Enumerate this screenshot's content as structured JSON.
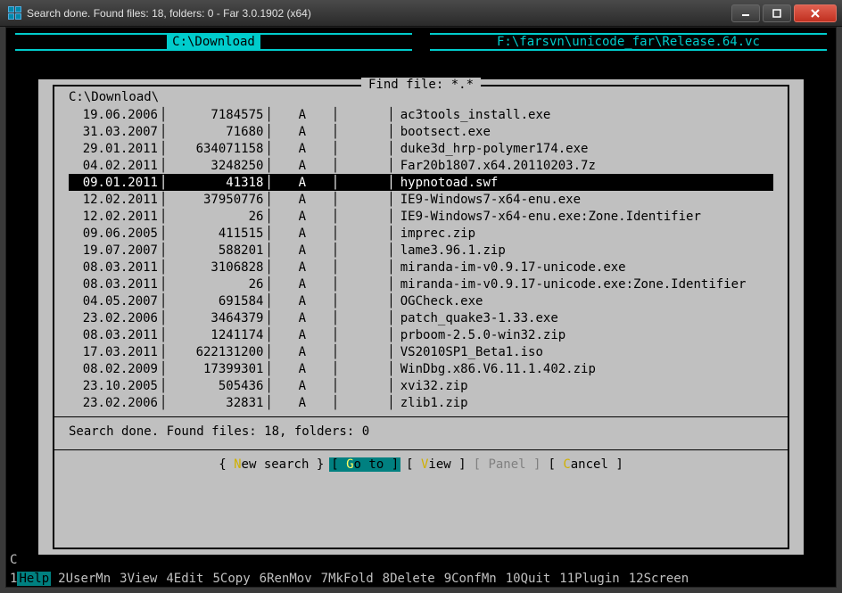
{
  "window": {
    "title": "Search done. Found files: 18, folders: 0 - Far 3.0.1902 (x64)"
  },
  "panels": {
    "left": "C:\\Download",
    "right": "F:\\farsvn\\unicode_far\\Release.64.vc"
  },
  "dialog": {
    "title": " Find file: *.* ",
    "path": "C:\\Download\\",
    "rows": [
      {
        "date": "19.06.2006",
        "size": "7184575",
        "attr": "A",
        "name": "ac3tools_install.exe",
        "selected": false
      },
      {
        "date": "31.03.2007",
        "size": "71680",
        "attr": "A",
        "name": "bootsect.exe",
        "selected": false
      },
      {
        "date": "29.01.2011",
        "size": "634071158",
        "attr": "A",
        "name": "duke3d_hrp-polymer174.exe",
        "selected": false
      },
      {
        "date": "04.02.2011",
        "size": "3248250",
        "attr": "A",
        "name": "Far20b1807.x64.20110203.7z",
        "selected": false
      },
      {
        "date": "09.01.2011",
        "size": "41318",
        "attr": "A",
        "name": "hypnotoad.swf",
        "selected": true
      },
      {
        "date": "12.02.2011",
        "size": "37950776",
        "attr": "A",
        "name": "IE9-Windows7-x64-enu.exe",
        "selected": false
      },
      {
        "date": "12.02.2011",
        "size": "26",
        "attr": "A",
        "name": "IE9-Windows7-x64-enu.exe:Zone.Identifier",
        "selected": false
      },
      {
        "date": "09.06.2005",
        "size": "411515",
        "attr": "A",
        "name": "imprec.zip",
        "selected": false
      },
      {
        "date": "19.07.2007",
        "size": "588201",
        "attr": "A",
        "name": "lame3.96.1.zip",
        "selected": false
      },
      {
        "date": "08.03.2011",
        "size": "3106828",
        "attr": "A",
        "name": "miranda-im-v0.9.17-unicode.exe",
        "selected": false
      },
      {
        "date": "08.03.2011",
        "size": "26",
        "attr": "A",
        "name": "miranda-im-v0.9.17-unicode.exe:Zone.Identifier",
        "selected": false
      },
      {
        "date": "04.05.2007",
        "size": "691584",
        "attr": "A",
        "name": "OGCheck.exe",
        "selected": false
      },
      {
        "date": "23.02.2006",
        "size": "3464379",
        "attr": "A",
        "name": "patch_quake3-1.33.exe",
        "selected": false
      },
      {
        "date": "08.03.2011",
        "size": "1241174",
        "attr": "A",
        "name": "prboom-2.5.0-win32.zip",
        "selected": false
      },
      {
        "date": "17.03.2011",
        "size": "622131200",
        "attr": "A",
        "name": "VS2010SP1_Beta1.iso",
        "selected": false
      },
      {
        "date": "08.02.2009",
        "size": "17399301",
        "attr": "A",
        "name": "WinDbg.x86.V6.11.1.402.zip",
        "selected": false
      },
      {
        "date": "23.10.2005",
        "size": "505436",
        "attr": "A",
        "name": "xvi32.zip",
        "selected": false
      },
      {
        "date": "23.02.2006",
        "size": "32831",
        "attr": "A",
        "name": "zlib1.zip",
        "selected": false
      }
    ],
    "status": "Search done. Found files: 18, folders: 0",
    "buttons": {
      "new_search": "ew search",
      "goto": "o to",
      "view": "iew",
      "panel": "Panel",
      "cancel": "ancel"
    }
  },
  "prompt": "C",
  "keybar": [
    {
      "n": "1",
      "l": "Help",
      "hl": true
    },
    {
      "n": "2",
      "l": "UserMn"
    },
    {
      "n": "3",
      "l": "View"
    },
    {
      "n": "4",
      "l": "Edit"
    },
    {
      "n": "5",
      "l": "Copy"
    },
    {
      "n": "6",
      "l": "RenMov"
    },
    {
      "n": "7",
      "l": "MkFold"
    },
    {
      "n": "8",
      "l": "Delete"
    },
    {
      "n": "9",
      "l": "ConfMn"
    },
    {
      "n": "10",
      "l": "Quit"
    },
    {
      "n": "11",
      "l": "Plugin"
    },
    {
      "n": "12",
      "l": "Screen"
    }
  ]
}
